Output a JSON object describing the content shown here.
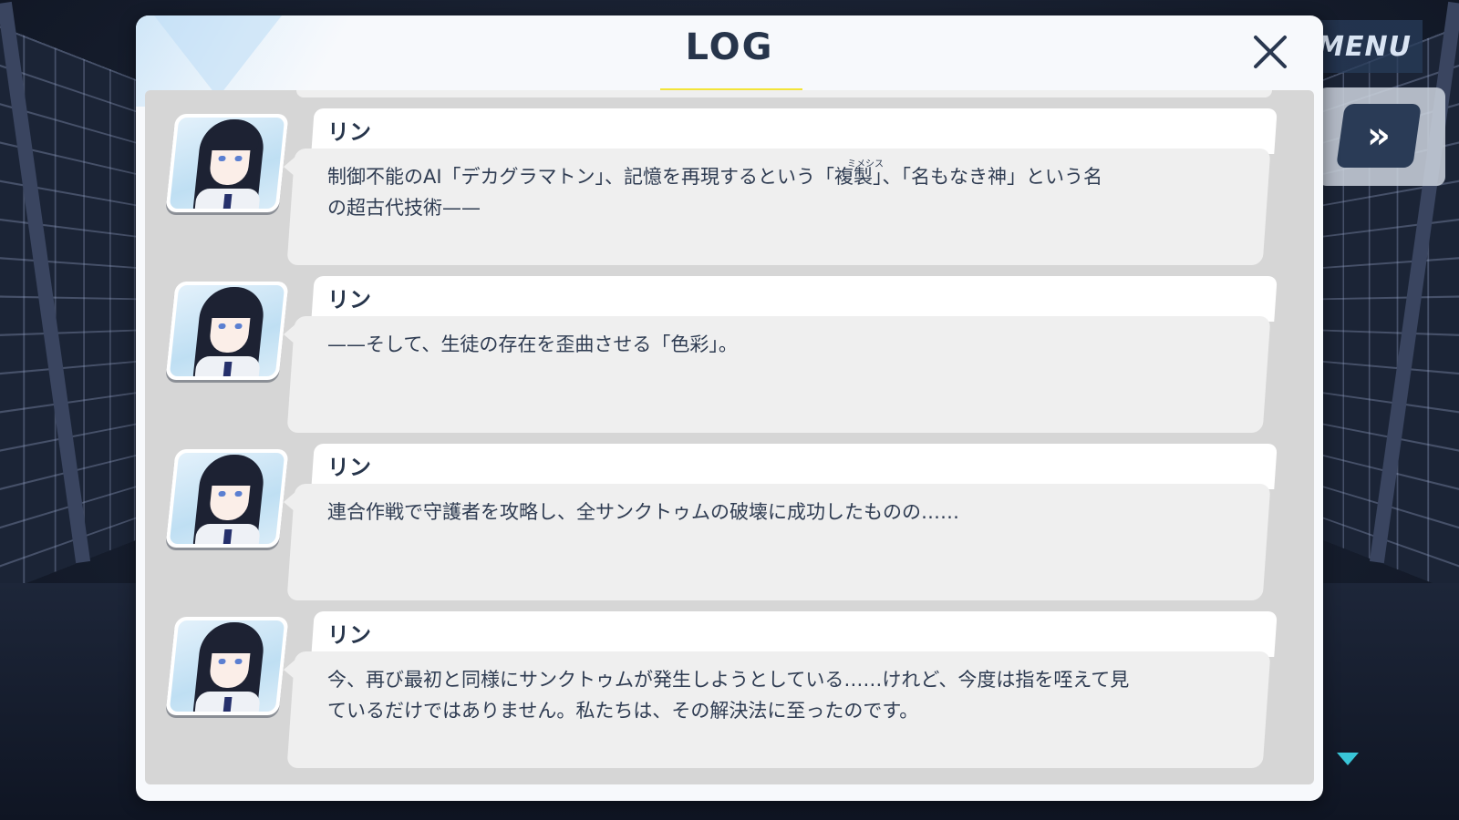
{
  "log": {
    "title": "LOG"
  },
  "hud": {
    "menu_label": "MENU",
    "fast_forward_label": "»"
  },
  "entries": [
    {
      "speaker": "リン",
      "text": "制御不能のAI「デカグラマトン」、記憶を再現するという「複製」、「名もなき神」という名\nの超古代技術——"
    },
    {
      "speaker": "リン",
      "text": "——そして、生徒の存在を歪曲させる「色彩」。"
    },
    {
      "speaker": "リン",
      "text": "連合作戦で守護者を攻略し、全サンクトゥムの破壊に成功したものの……"
    },
    {
      "speaker": "リン",
      "text": "今、再び最初と同様にサンクトゥムが発生しようとしている……けれど、今度は指を咥えて見\nているだけではありません。私たちは、その解決法に至ったのです。"
    }
  ],
  "ruby": {
    "text": "ミメシス"
  },
  "colors": {
    "title_underline": "#f3e43a",
    "title_text": "#27354b",
    "bubble_bg": "#efefef",
    "scroll_bg": "#d6d6d6",
    "accent_arrow": "#39c6d8"
  },
  "icons": {
    "close": "close-icon",
    "fast_forward": "fast-forward-icon",
    "scroll_down": "chevron-down-icon"
  }
}
